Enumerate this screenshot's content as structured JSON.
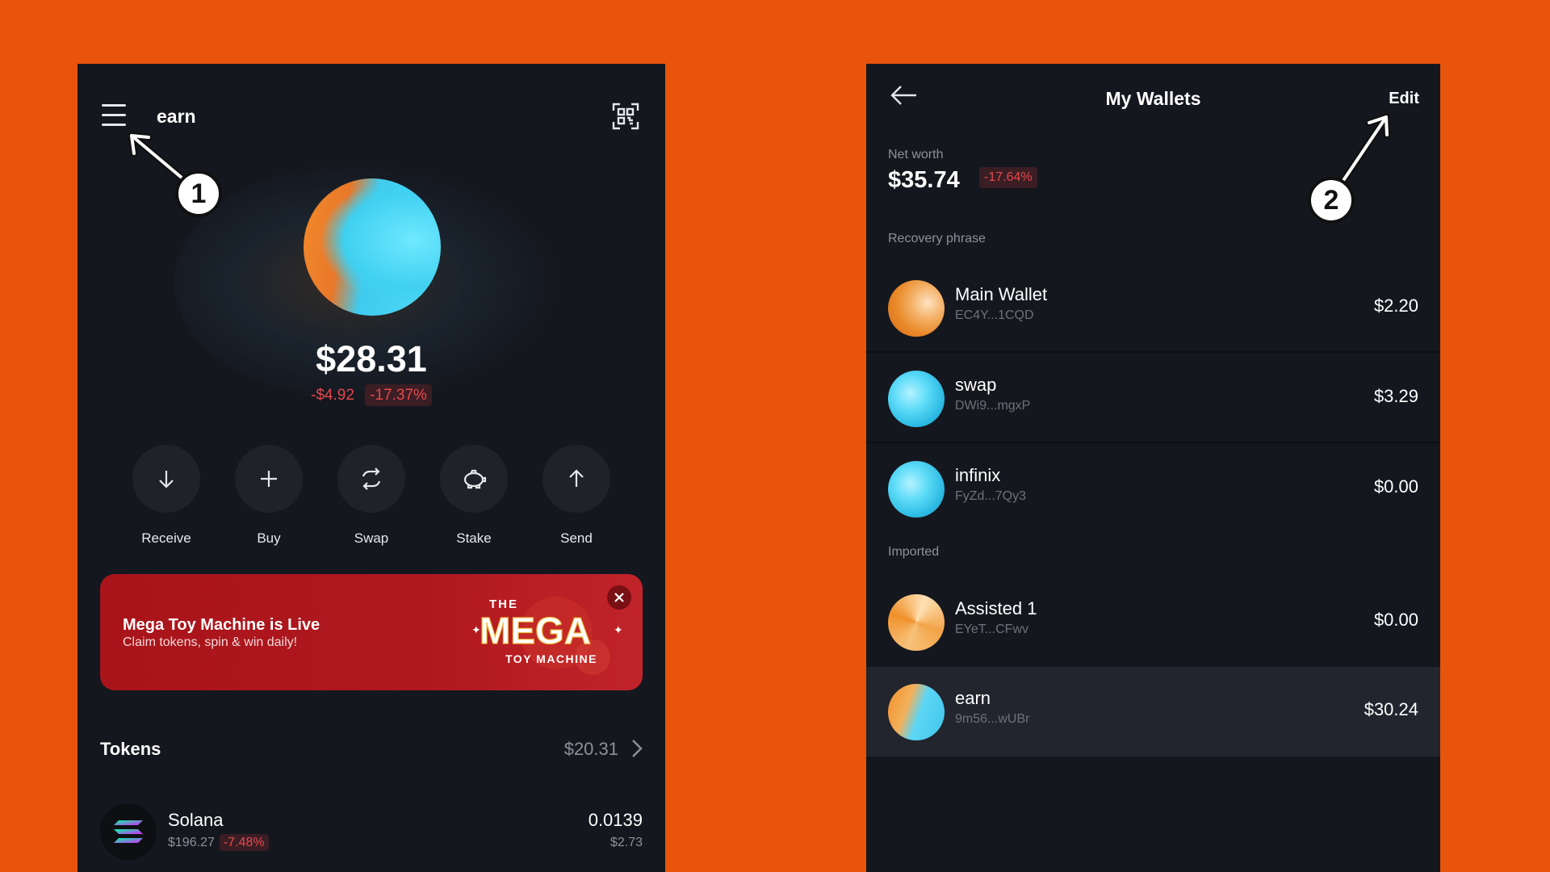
{
  "left_screen": {
    "wallet_name": "earn",
    "balance": "$28.31",
    "change_abs": "-$4.92",
    "change_pct": "-17.37%",
    "actions": [
      {
        "label": "Receive",
        "icon": "arrow-down-icon"
      },
      {
        "label": "Buy",
        "icon": "plus-icon"
      },
      {
        "label": "Swap",
        "icon": "swap-icon"
      },
      {
        "label": "Stake",
        "icon": "piggy-bank-icon"
      },
      {
        "label": "Send",
        "icon": "arrow-up-icon"
      }
    ],
    "promo": {
      "title": "Mega Toy Machine is Live",
      "subtitle": "Claim tokens, spin & win daily!",
      "logo_text_top": "THE",
      "logo_text_main": "MEGA",
      "logo_text_bottom": "TOY MACHINE"
    },
    "tokens": {
      "title": "Tokens",
      "total": "$20.31",
      "items": [
        {
          "name": "Solana",
          "price": "$196.27",
          "change": "-7.48%",
          "amount": "0.0139",
          "value": "$2.73"
        }
      ]
    }
  },
  "right_screen": {
    "title": "My Wallets",
    "edit_label": "Edit",
    "net_worth_label": "Net worth",
    "net_worth": "$35.74",
    "net_worth_change": "-17.64%",
    "recovery_label": "Recovery phrase",
    "imported_label": "Imported",
    "recovery_wallets": [
      {
        "name": "Main Wallet",
        "address": "EC4Y...1CQD",
        "balance": "$2.20"
      },
      {
        "name": "swap",
        "address": "DWi9...mgxP",
        "balance": "$3.29"
      },
      {
        "name": "infinix",
        "address": "FyZd...7Qy3",
        "balance": "$0.00"
      }
    ],
    "imported_wallets": [
      {
        "name": "Assisted 1",
        "address": "EYeT...CFwv",
        "balance": "$0.00"
      },
      {
        "name": "earn",
        "address": "9m56...wUBr",
        "balance": "$30.24"
      }
    ]
  },
  "annotations": {
    "step1": "1",
    "step2": "2"
  },
  "colors": {
    "background": "#E8540C",
    "panel": "#15171E",
    "negative": "#E5484D",
    "promo": "#A8141A"
  }
}
